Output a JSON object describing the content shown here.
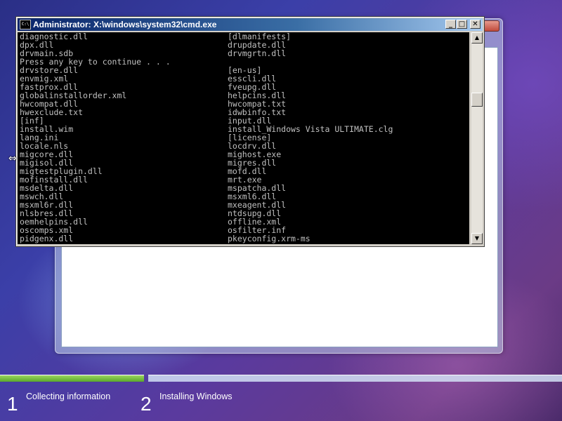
{
  "cmd": {
    "title": "Administrator: X:\\windows\\system32\\cmd.exe",
    "icon_label": "C:\\",
    "buttons": {
      "minimize": "_",
      "maximize": "□",
      "close": "✕"
    },
    "lines": [
      [
        "diagnostic.dll",
        "[dlmanifests]"
      ],
      [
        "dpx.dll",
        "drupdate.dll"
      ],
      [
        "drvmain.sdb",
        "drvmgrtn.dll"
      ],
      [
        "Press any key to continue . . .",
        ""
      ],
      [
        "drvstore.dll",
        "[en-us]"
      ],
      [
        "envmig.xml",
        "esscli.dll"
      ],
      [
        "fastprox.dll",
        "fveupg.dll"
      ],
      [
        "globalinstallorder.xml",
        "helpcins.dll"
      ],
      [
        "hwcompat.dll",
        "hwcompat.txt"
      ],
      [
        "hwexclude.txt",
        "idwbinfo.txt"
      ],
      [
        "[inf]",
        "input.dll"
      ],
      [
        "install.wim",
        "install_Windows Vista ULTIMATE.clg"
      ],
      [
        "lang.ini",
        "[license]"
      ],
      [
        "locale.nls",
        "locdrv.dll"
      ],
      [
        "migcore.dll",
        "mighost.exe"
      ],
      [
        "migisol.dll",
        "migres.dll"
      ],
      [
        "migtestplugin.dll",
        "mofd.dll"
      ],
      [
        "mofinstall.dll",
        "mrt.exe"
      ],
      [
        "msdelta.dll",
        "mspatcha.dll"
      ],
      [
        "mswch.dll",
        "msxml6.dll"
      ],
      [
        "msxml6r.dll",
        "mxeagent.dll"
      ],
      [
        "nlsbres.dll",
        "ntdsupg.dll"
      ],
      [
        "oemhelpins.dll",
        "offline.xml"
      ],
      [
        "oscomps.xml",
        "osfilter.inf"
      ],
      [
        "pidgenx.dll",
        "pkeyconfig.xrm-ms"
      ]
    ],
    "scroll_position": 0.28
  },
  "steps": [
    {
      "number": "1",
      "label": "Collecting information",
      "progress": 1.0
    },
    {
      "number": "2",
      "label": "Installing Windows",
      "progress": 0.0
    }
  ]
}
